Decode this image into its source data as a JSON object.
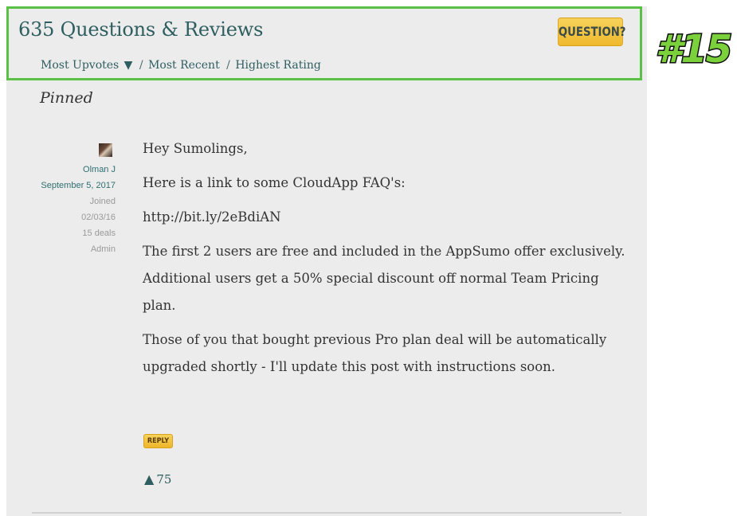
{
  "header": {
    "title": "635 Questions & Reviews",
    "question_button": "QUESTION?",
    "sort": {
      "most_upvotes": "Most Upvotes",
      "sort_arrow": "▼",
      "separator": "/",
      "most_recent": "Most Recent",
      "highest_rating": "Highest Rating"
    }
  },
  "badge": "#15",
  "pinned_label": "Pinned",
  "post": {
    "author": "Olman J",
    "date": "September 5, 2017",
    "joined_label": "Joined",
    "joined_date": "02/03/16",
    "deals": "15 deals",
    "role": "Admin",
    "paragraphs": [
      "Hey Sumolings,",
      "Here is a link to some CloudApp FAQ's:",
      "http://bit.ly/2eBdiAN",
      "The first 2 users are free and included in the AppSumo offer exclusively. Additional users get a 50% special discount off normal Team Pricing plan.",
      "Those of you that bought previous Pro plan deal will be automatically upgraded shortly - I'll update this post with instructions soon."
    ],
    "reply_label": "REPLY",
    "upvote_arrow": "▲",
    "upvotes": "75"
  },
  "colors": {
    "accent_teal": "#2f5e60",
    "highlight_green": "#5bc146",
    "button_yellow": "#efb92d",
    "panel_bg": "#ececec"
  }
}
